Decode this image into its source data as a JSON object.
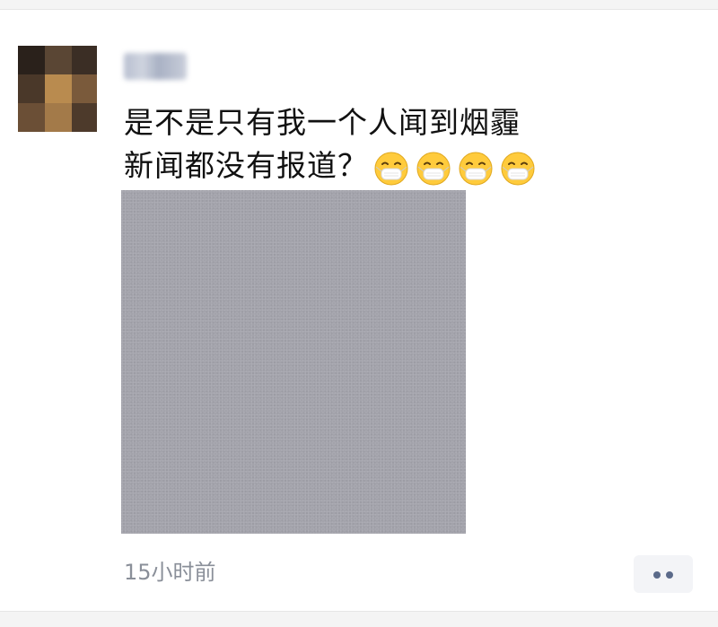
{
  "post": {
    "username": "●●●",
    "text_line1": "是不是只有我一个人闻到烟霾",
    "text_line2": "新闻都没有报道？",
    "emojis": [
      "mask-face-icon",
      "mask-face-icon",
      "mask-face-icon",
      "mask-face-icon"
    ],
    "timestamp": "15小时前",
    "more_label": "••"
  },
  "colors": {
    "text": "#111111",
    "timestamp": "#8a8f99",
    "photo_gray": "#a3a3ab",
    "more_dots": "#5b6a8a",
    "more_bg": "#f3f4f7"
  }
}
